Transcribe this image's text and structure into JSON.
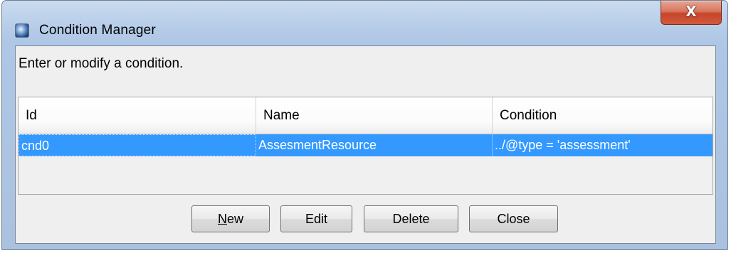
{
  "window": {
    "title": "Condition Manager",
    "close_glyph": "X"
  },
  "instruction": "Enter or modify a condition.",
  "table": {
    "columns": [
      "Id",
      "Name",
      "Condition"
    ],
    "rows": [
      {
        "id": "cnd0",
        "name": "AssesmentResource",
        "condition": "../@type = 'assessment'",
        "selected": true
      }
    ]
  },
  "buttons": {
    "new": {
      "mnemonic": "N",
      "rest": "ew"
    },
    "edit": "Edit",
    "delete": "Delete",
    "close": "Close"
  },
  "colors": {
    "selection": "#3399ff",
    "close_button": "#c7442a"
  },
  "icons": {
    "app": "app-globe-icon"
  }
}
